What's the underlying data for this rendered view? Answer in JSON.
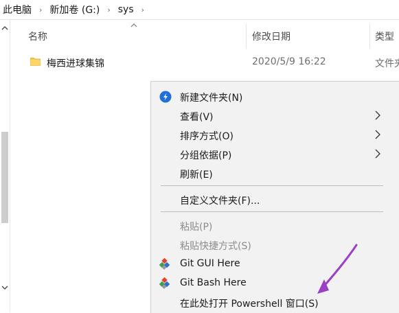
{
  "breadcrumb": {
    "items": [
      "此电脑",
      "新加卷 (G:)",
      "sys"
    ],
    "separator": "›"
  },
  "columns": {
    "name": "名称",
    "date_modified": "修改日期",
    "type": "类型"
  },
  "files": [
    {
      "name": "梅西进球集锦",
      "date": "2020/5/9 16:22",
      "type": "文件夹",
      "icon": "folder-icon"
    }
  ],
  "context_menu": {
    "items": [
      {
        "label": "新建文件夹(N)",
        "icon": "new-folder-icon",
        "enabled": true
      },
      {
        "label": "查看(V)",
        "submenu": true,
        "enabled": true
      },
      {
        "label": "排序方式(O)",
        "submenu": true,
        "enabled": true
      },
      {
        "label": "分组依据(P)",
        "submenu": true,
        "enabled": true
      },
      {
        "label": "刷新(E)",
        "enabled": true
      },
      {
        "label": "自定义文件夹(F)...",
        "enabled": true
      },
      {
        "label": "粘贴(P)",
        "enabled": false
      },
      {
        "label": "粘贴快捷方式(S)",
        "enabled": false
      },
      {
        "label": "Git GUI Here",
        "icon": "git-icon",
        "enabled": true
      },
      {
        "label": "Git Bash Here",
        "icon": "git-icon",
        "enabled": true
      },
      {
        "label": "在此处打开 Powershell 窗口(S)",
        "enabled": true
      }
    ]
  },
  "colors": {
    "annotation_arrow": "#9b3fc4",
    "menu_background": "#f2f2f2",
    "folder": "#f8c848"
  }
}
